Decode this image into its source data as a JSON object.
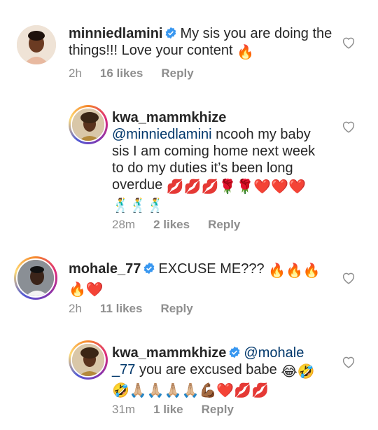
{
  "comments": [
    {
      "username": "minniedlamini",
      "verified": true,
      "text": "My sis you are doing the things!!! Love your content",
      "emojis": "🔥",
      "time": "2h",
      "likes": "16 likes",
      "reply": "Reply"
    },
    {
      "username": "kwa_mammkhize",
      "verified": false,
      "mention": "@minniedlamini",
      "text": "ncooh my baby sis I am coming home next week to do my duties it’s been long overdue",
      "emojis": "💋💋💋🌹🌹❤️❤️❤️",
      "emojis2": "🕺🕺🕺",
      "time": "28m",
      "likes": "2 likes",
      "reply": "Reply"
    },
    {
      "username": "mohale_77",
      "verified": true,
      "text": "EXCUSE ME???",
      "emojis": "🔥🔥🔥",
      "emojis2": "🔥❤️",
      "time": "2h",
      "likes": "11 likes",
      "reply": "Reply"
    },
    {
      "username": "kwa_mammkhize",
      "verified": true,
      "mention": "@mohale _77",
      "text": "you are excused babe",
      "emojis": "😂🤣",
      "emojis2": "🤣🙏🏼🙏🏼🙏🏼🙏🏼💪🏾❤️💋💋",
      "time": "31m",
      "likes": "1 like",
      "reply": "Reply"
    }
  ],
  "icons": {
    "like": "heart-outline-icon",
    "verified": "verified-badge-icon"
  },
  "colors": {
    "text": "#262626",
    "meta": "#8e8e8e",
    "mention": "#00376b",
    "verified": "#3897f0"
  }
}
